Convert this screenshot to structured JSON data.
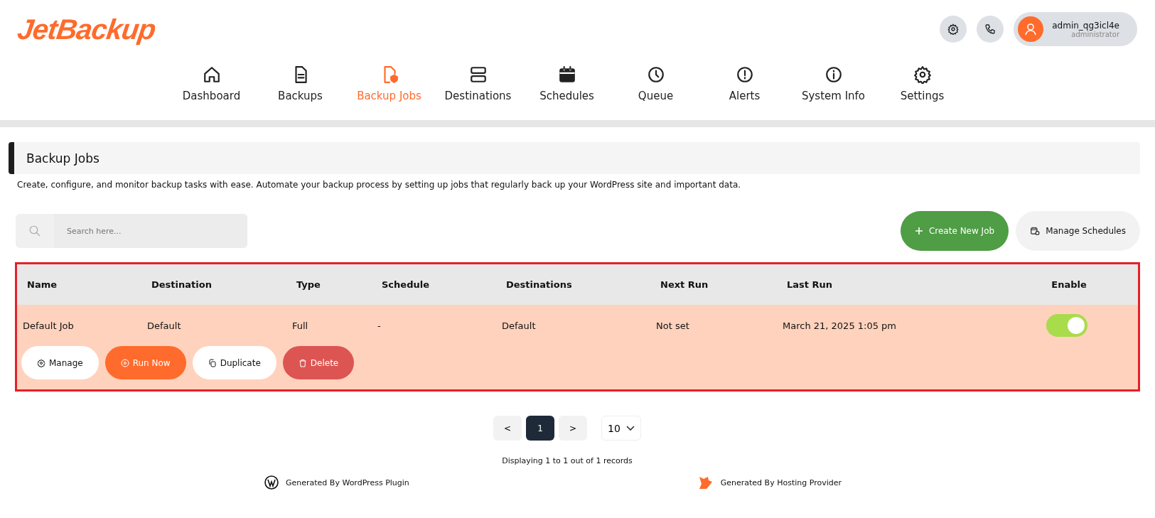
{
  "logo": "JetBackup",
  "user": {
    "name": "admin_qg3icl4e",
    "role": "administrator"
  },
  "nav": [
    {
      "label": "Dashboard",
      "kind": "home",
      "selected": false
    },
    {
      "label": "Backups",
      "kind": "file",
      "selected": false
    },
    {
      "label": "Backup Jobs",
      "kind": "filejob",
      "selected": true
    },
    {
      "label": "Destinations",
      "kind": "server",
      "selected": false
    },
    {
      "label": "Schedules",
      "kind": "calendar",
      "selected": false
    },
    {
      "label": "Queue",
      "kind": "clock",
      "selected": false
    },
    {
      "label": "Alerts",
      "kind": "alert",
      "selected": false
    },
    {
      "label": "System Info",
      "kind": "info",
      "selected": false
    },
    {
      "label": "Settings",
      "kind": "gear",
      "selected": false
    }
  ],
  "page": {
    "title": "Backup Jobs",
    "description": "Create, configure, and monitor backup tasks with ease. Automate your backup process by setting up jobs that regularly back up your WordPress site and important data."
  },
  "search": {
    "placeholder": "Search here..."
  },
  "actions": [
    {
      "label": "Create New Job",
      "kind": "primary"
    },
    {
      "label": "Manage Schedules",
      "kind": "secondary"
    }
  ],
  "table": {
    "columns": [
      "Name",
      "Destination",
      "Type",
      "Schedule",
      "Destinations",
      "Next Run",
      "Last Run",
      "Enable"
    ],
    "rows": [
      {
        "cells": [
          "Default Job",
          "Default",
          "Full",
          "-",
          "Default",
          "Not set",
          "March 21, 2025 1:05 pm"
        ],
        "enabled": true,
        "buttons": [
          {
            "label": "Manage",
            "kind": "manage"
          },
          {
            "label": "Run Now",
            "kind": "run"
          },
          {
            "label": "Duplicate",
            "kind": "duplicate"
          },
          {
            "label": "Delete",
            "kind": "delete"
          }
        ]
      }
    ]
  },
  "pagination": {
    "prev": "<",
    "pages": [
      {
        "label": "1",
        "selected": true
      }
    ],
    "next": ">",
    "per_page": "10",
    "summary": "Displaying 1 to 1 out of 1 records"
  },
  "footer": [
    "Generated By WordPress Plugin",
    "Generated By Hosting Provider"
  ]
}
